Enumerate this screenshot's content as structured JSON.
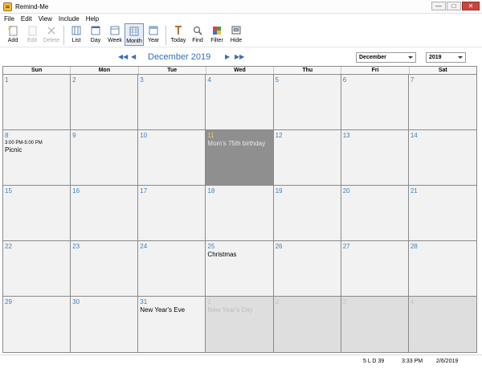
{
  "window": {
    "title": "Remind-Me",
    "minimize": "—",
    "maximize": "□",
    "close": "✕"
  },
  "menu": [
    "File",
    "Edit",
    "View",
    "Include",
    "Help"
  ],
  "toolbar": {
    "add": "Add",
    "edit": "Edit",
    "delete": "Delete",
    "list": "List",
    "day": "Day",
    "week": "Week",
    "month": "Month",
    "year": "Year",
    "today": "Today",
    "find": "Find",
    "filter": "Filter",
    "hide": "Hide"
  },
  "nav": {
    "first": "◀◀",
    "prev": "◀",
    "next": "▶",
    "last": "▶▶",
    "title": "December 2019",
    "month_select": "December",
    "year_select": "2019"
  },
  "weekdays": [
    "Sun",
    "Mon",
    "Tue",
    "Wed",
    "Thu",
    "Fri",
    "Sat"
  ],
  "weeks": [
    [
      {
        "num": "1"
      },
      {
        "num": "2"
      },
      {
        "num": "3"
      },
      {
        "num": "4"
      },
      {
        "num": "5"
      },
      {
        "num": "6"
      },
      {
        "num": "7"
      }
    ],
    [
      {
        "num": "8",
        "time": "3:00 PM-5:00 PM",
        "event": "Picnic"
      },
      {
        "num": "9"
      },
      {
        "num": "10"
      },
      {
        "num": "11",
        "event": "Mom's 75th birthday",
        "selected": true
      },
      {
        "num": "12"
      },
      {
        "num": "13"
      },
      {
        "num": "14"
      }
    ],
    [
      {
        "num": "15"
      },
      {
        "num": "16"
      },
      {
        "num": "17"
      },
      {
        "num": "18"
      },
      {
        "num": "19"
      },
      {
        "num": "20"
      },
      {
        "num": "21"
      }
    ],
    [
      {
        "num": "22"
      },
      {
        "num": "23"
      },
      {
        "num": "24"
      },
      {
        "num": "25",
        "event": "Christmas"
      },
      {
        "num": "26"
      },
      {
        "num": "27"
      },
      {
        "num": "28"
      }
    ],
    [
      {
        "num": "29"
      },
      {
        "num": "30"
      },
      {
        "num": "31",
        "event": "New Year's Eve"
      },
      {
        "num": "1",
        "event": "New Year's Day",
        "other": true
      },
      {
        "num": "2",
        "other": true
      },
      {
        "num": "3",
        "other": true
      },
      {
        "num": "4",
        "other": true
      }
    ]
  ],
  "status": {
    "counts": "5 L D 39",
    "time": "3:33 PM",
    "date": "2/6/2019"
  },
  "colors": {
    "accent": "#2f6fb8",
    "day_number": "#3b82c4",
    "selected_bg": "#8f8f8f",
    "other_month_bg": "#dedede"
  }
}
